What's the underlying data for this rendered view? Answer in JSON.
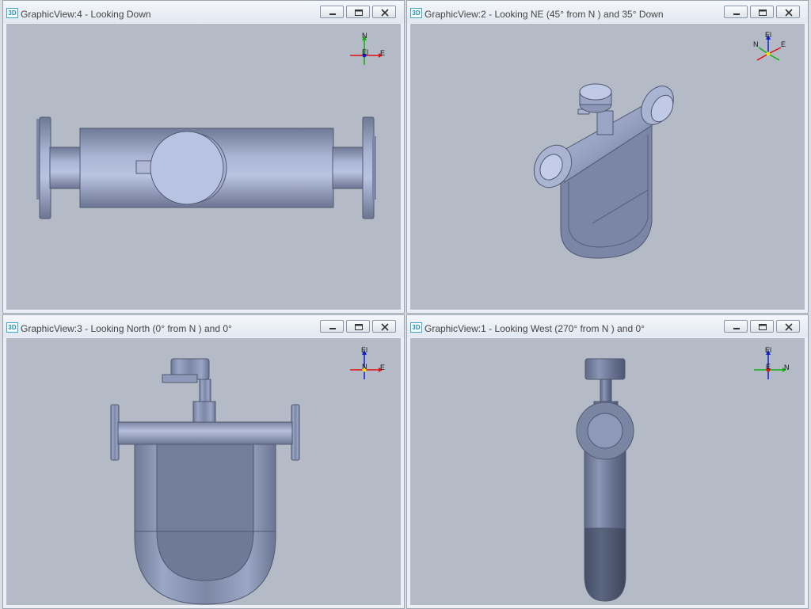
{
  "windows": [
    {
      "title": "GraphicView:4 - Looking Down",
      "axis_labels": [
        "N",
        "El",
        "E"
      ]
    },
    {
      "title": "GraphicView:2 - Looking NE (45° from N ) and 35° Down",
      "axis_labels": [
        "El",
        "N",
        "E"
      ]
    },
    {
      "title": "GraphicView:3 - Looking North (0° from N ) and 0°",
      "axis_labels": [
        "El",
        "N",
        "E"
      ]
    },
    {
      "title": "GraphicView:1 - Looking West (270° from N ) and 0°",
      "axis_labels": [
        "El",
        "E",
        "N"
      ]
    }
  ],
  "app_icon_label": "3D",
  "colors": {
    "viewport_background": "#b4bac6",
    "model_body": "#7f8aa8",
    "model_highlight": "#b8c2e0",
    "axis_red": "#e01010",
    "axis_green": "#10b010",
    "axis_blue": "#1020d0"
  },
  "icons": [
    "minimize-icon",
    "restore-icon",
    "close-icon",
    "axis-triad-icon"
  ]
}
